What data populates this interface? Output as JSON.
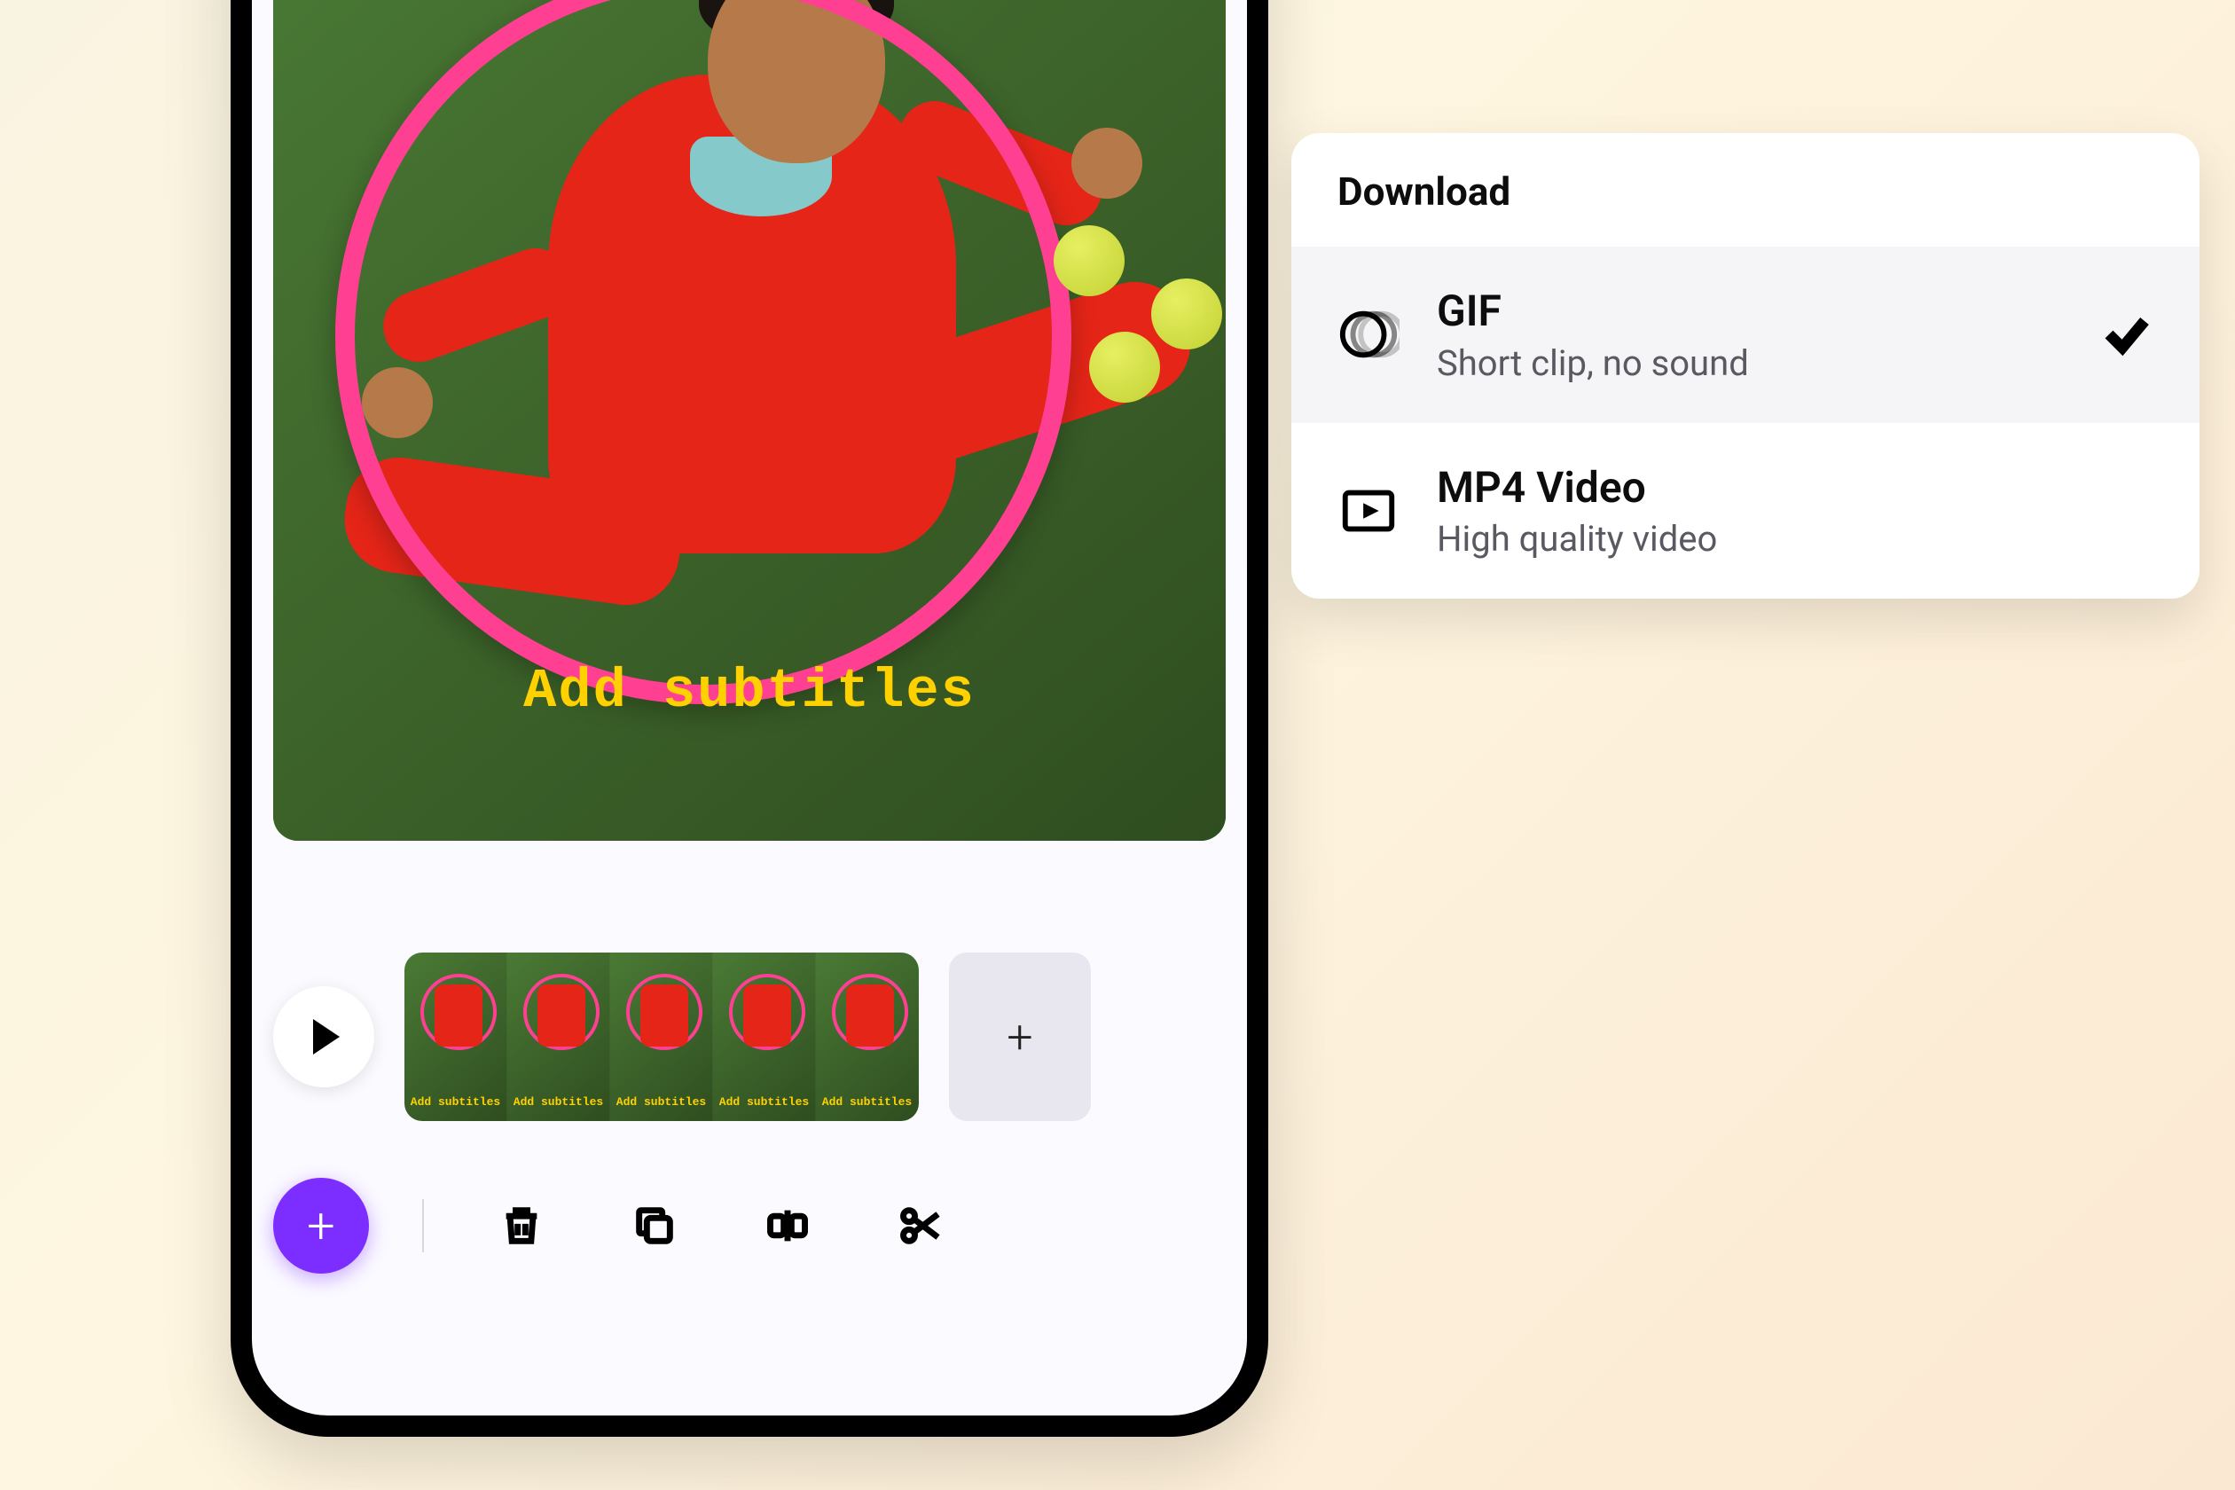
{
  "preview": {
    "subtitle_overlay": "Add subtitles",
    "thumb_label": "Add subtitles"
  },
  "timeline": {
    "play_label": "Play",
    "add_clip_label": "+"
  },
  "toolbar": {
    "add_label": "+",
    "delete_label": "Delete",
    "duplicate_label": "Duplicate",
    "split_label": "Split",
    "cut_label": "Cut"
  },
  "download": {
    "title": "Download",
    "options": [
      {
        "title": "GIF",
        "subtitle": "Short clip, no sound",
        "selected": true,
        "icon": "gif"
      },
      {
        "title": "MP4 Video",
        "subtitle": "High quality video",
        "selected": false,
        "icon": "mp4"
      }
    ]
  }
}
